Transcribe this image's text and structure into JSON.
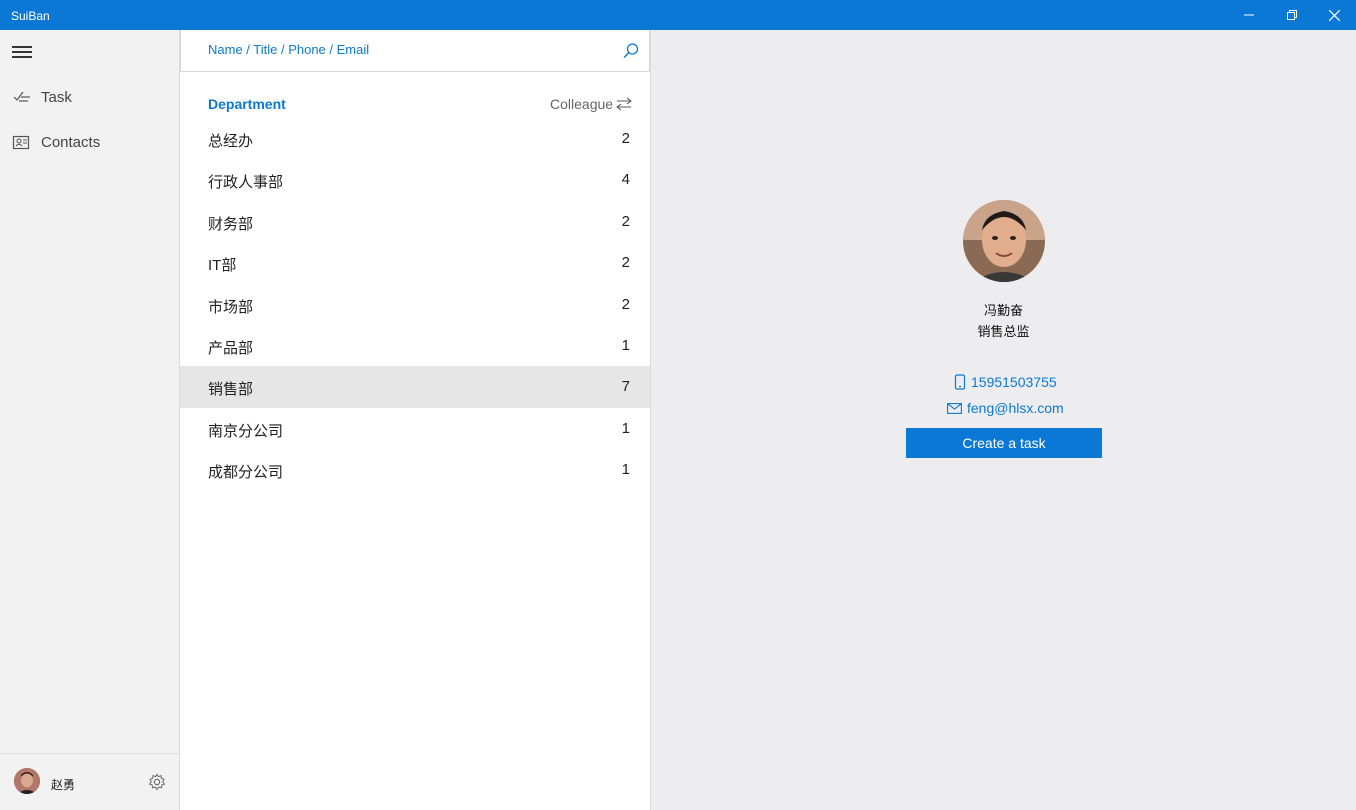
{
  "window": {
    "title": "SuiBan"
  },
  "nav": {
    "items": [
      {
        "label": "Task",
        "icon": "task-check-icon"
      },
      {
        "label": "Contacts",
        "icon": "contacts-card-icon"
      }
    ],
    "user": {
      "name": "赵勇"
    }
  },
  "search": {
    "placeholder": "Name / Title / Phone / Email"
  },
  "list": {
    "header_left": "Department",
    "header_right": "Colleague",
    "departments": [
      {
        "name": "总经办",
        "count": "2"
      },
      {
        "name": "行政人事部",
        "count": "4"
      },
      {
        "name": "财务部",
        "count": "2"
      },
      {
        "name": "IT部",
        "count": "2"
      },
      {
        "name": "市场部",
        "count": "2"
      },
      {
        "name": "产品部",
        "count": "1"
      },
      {
        "name": "销售部",
        "count": "7",
        "selected": true
      },
      {
        "name": "南京分公司",
        "count": "1"
      },
      {
        "name": "成都分公司",
        "count": "1"
      }
    ]
  },
  "detail": {
    "name": "冯勤奋",
    "title": "销售总监",
    "phone": "15951503755",
    "email": "feng@hlsx.com",
    "create_task_label": "Create a task"
  },
  "colors": {
    "accent": "#0c78d6",
    "selected_row": "#e6e6e6",
    "pane_bg": "#ededef"
  }
}
